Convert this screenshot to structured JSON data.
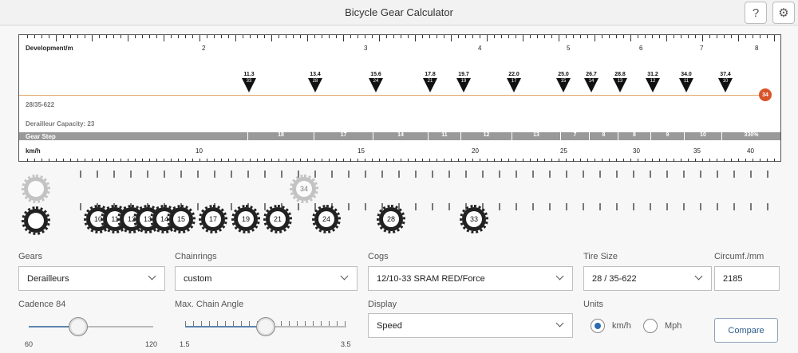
{
  "app": {
    "title": "Bicycle Gear Calculator"
  },
  "chart": {
    "development_label": "Development/m",
    "development_ticks": [
      "2",
      "3",
      "4",
      "5",
      "6",
      "7",
      "8"
    ],
    "setup": "28/35-622",
    "derailleur_capacity": "Derailleur Capacity: 23",
    "chainring_marker": "34",
    "gears": [
      {
        "dev": "11.3",
        "cog": "33"
      },
      {
        "dev": "13.4",
        "cog": "28"
      },
      {
        "dev": "15.6",
        "cog": "24"
      },
      {
        "dev": "17.8",
        "cog": "21"
      },
      {
        "dev": "19.7",
        "cog": "19"
      },
      {
        "dev": "22.0",
        "cog": "17"
      },
      {
        "dev": "25.0",
        "cog": "15"
      },
      {
        "dev": "26.7",
        "cog": "14"
      },
      {
        "dev": "28.8",
        "cog": "13"
      },
      {
        "dev": "31.2",
        "cog": "12"
      },
      {
        "dev": "34.0",
        "cog": "11"
      },
      {
        "dev": "37.4",
        "cog": "10"
      }
    ],
    "gear_step_label": "Gear Step",
    "gear_steps": [
      "18",
      "17",
      "14",
      "11",
      "12",
      "13",
      "7",
      "8",
      "8",
      "9",
      "10",
      "330%"
    ],
    "speed_label": "km/h",
    "speed_ticks": [
      "10",
      "15",
      "20",
      "25",
      "30",
      "35",
      "40"
    ]
  },
  "sprockets": {
    "chainring": "34",
    "cogs": [
      "10",
      "11",
      "12",
      "13",
      "14",
      "15",
      "17",
      "19",
      "21",
      "24",
      "28",
      "33"
    ]
  },
  "form": {
    "gears_label": "Gears",
    "gears_value": "Derailleurs",
    "chainrings_label": "Chainrings",
    "chainrings_value": "custom",
    "cogs_label": "Cogs",
    "cogs_value": "12/10-33 SRAM RED/Force",
    "tire_label": "Tire Size",
    "tire_value": "28 / 35-622",
    "circum_label": "Circumf./mm",
    "circum_value": "2185",
    "cadence_label": "Cadence 84",
    "cadence_min": "60",
    "cadence_max": "120",
    "cadence_value": 84,
    "angle_label": "Max. Chain Angle",
    "angle_min": "1.5",
    "angle_max": "3.5",
    "angle_value": 2.5,
    "display_label": "Display",
    "display_value": "Speed",
    "units_label": "Units",
    "unit_kmh": "km/h",
    "unit_mph": "Mph",
    "compare_label": "Compare"
  },
  "icons": {
    "help": "help-icon",
    "settings": "gear-icon"
  }
}
